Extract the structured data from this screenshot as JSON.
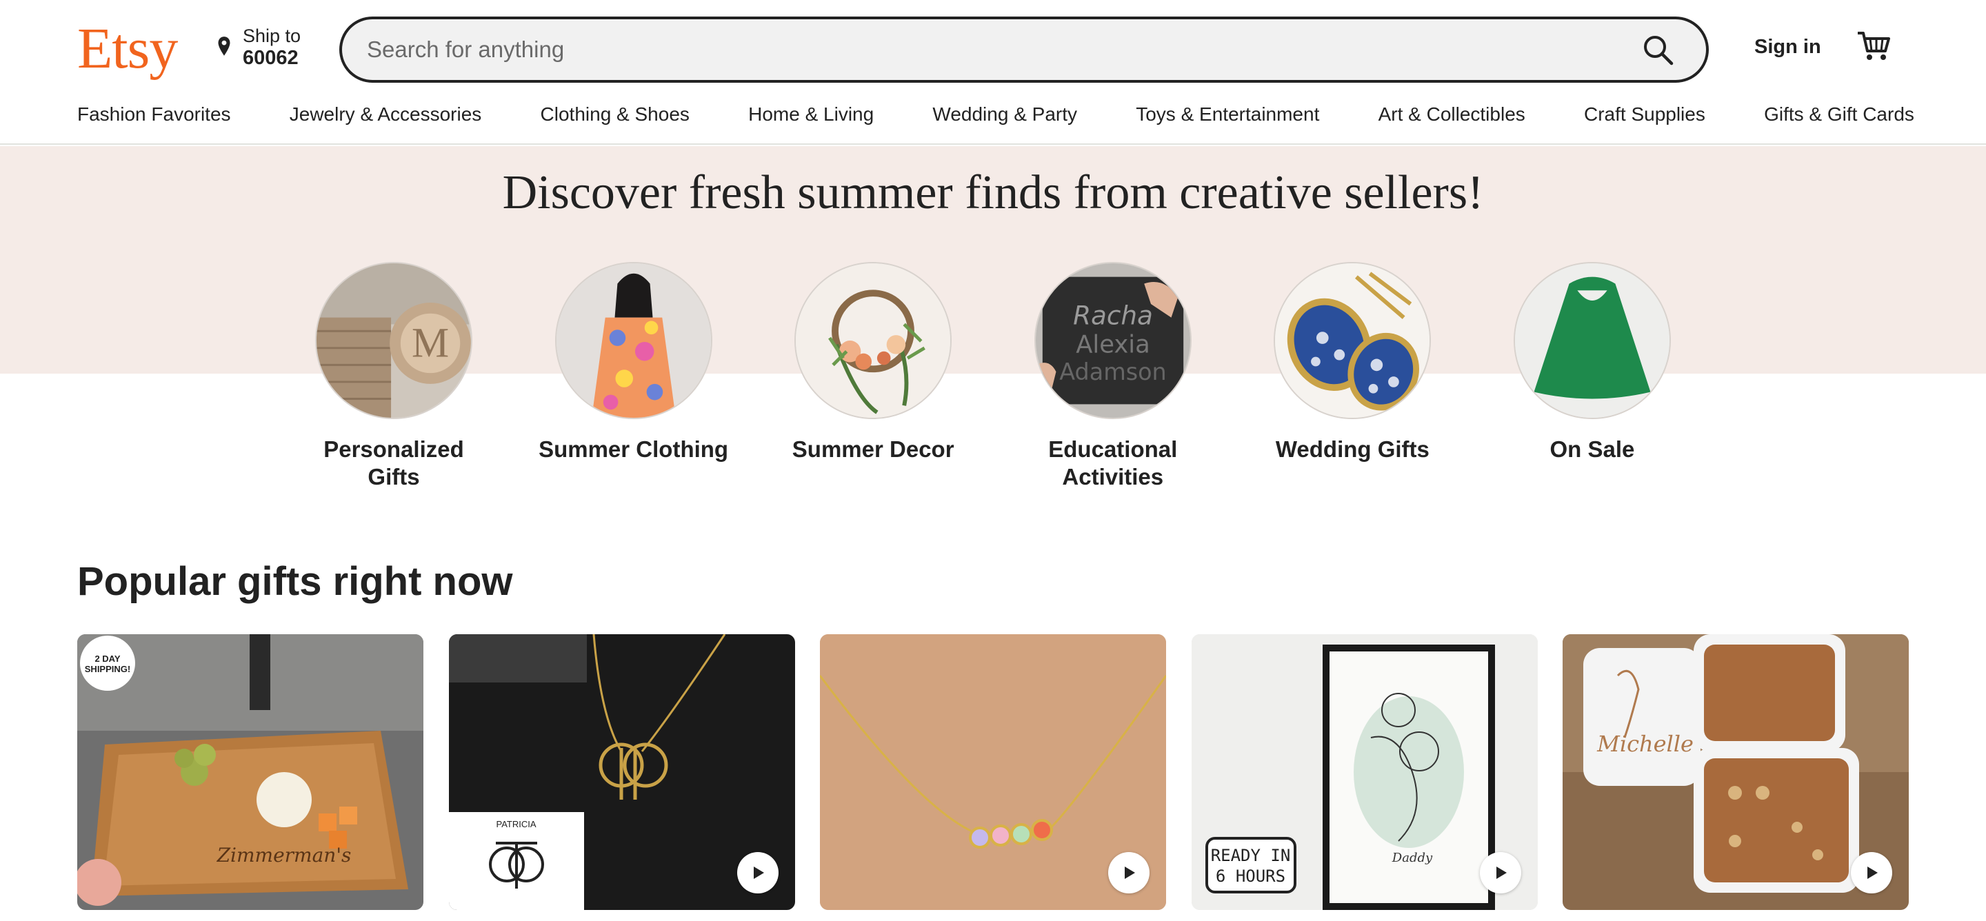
{
  "header": {
    "logo": "Etsy",
    "ship_to_label": "Ship to",
    "ship_to_zip": "60062",
    "search_placeholder": "Search for anything",
    "sign_in": "Sign in"
  },
  "categories": [
    "Fashion Favorites",
    "Jewelry & Accessories",
    "Clothing & Shoes",
    "Home & Living",
    "Wedding & Party",
    "Toys & Entertainment",
    "Art & Collectibles",
    "Craft Supplies",
    "Gifts & Gift Cards"
  ],
  "hero": {
    "title": "Discover fresh summer finds from creative sellers!",
    "circles": [
      {
        "label": "Personalized Gifts",
        "icon": "personalized-gifts-image"
      },
      {
        "label": "Summer Clothing",
        "icon": "summer-clothing-image"
      },
      {
        "label": "Summer Decor",
        "icon": "summer-decor-image"
      },
      {
        "label": "Educational Activities",
        "icon": "educational-activities-image"
      },
      {
        "label": "Wedding Gifts",
        "icon": "wedding-gifts-image"
      },
      {
        "label": "On Sale",
        "icon": "on-sale-image"
      }
    ]
  },
  "popular": {
    "title": "Popular gifts right now",
    "cards": [
      {
        "image": "cheese-board-image",
        "badge": "2 DAY SHIPPING!"
      },
      {
        "image": "initials-necklace-image",
        "overlay": "PATRICIA",
        "video": true
      },
      {
        "image": "birthstone-necklace-image",
        "video": true
      },
      {
        "image": "line-art-print-image",
        "overlay": "READY IN 6 HOURS",
        "video": true
      },
      {
        "image": "jewelry-box-image",
        "video": true
      }
    ]
  },
  "colors": {
    "brand": "#f1641e",
    "hero_band": "#f5ebe7",
    "text": "#222222"
  }
}
